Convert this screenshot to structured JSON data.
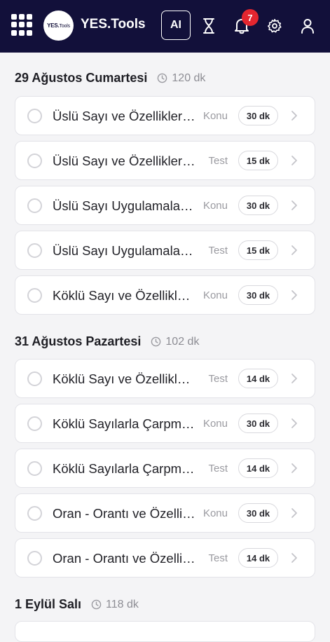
{
  "app": {
    "brand": "YES.Tools",
    "logo_text_bold": "YES.",
    "logo_text_light": "Tools",
    "ai_label": "AI",
    "notification_count": "7"
  },
  "sections": [
    {
      "date": "29 Ağustos Cumartesi",
      "duration": "120 dk",
      "items": [
        {
          "title": "Üslü Sayı ve Özellikleri ...",
          "type": "Konu",
          "duration": "30 dk"
        },
        {
          "title": "Üslü Sayı ve Özellikleri -...",
          "type": "Test",
          "duration": "15 dk"
        },
        {
          "title": "Üslü Sayı Uygulamaları...",
          "type": "Konu",
          "duration": "30 dk"
        },
        {
          "title": "Üslü Sayı Uygulamaları ...",
          "type": "Test",
          "duration": "15 dk"
        },
        {
          "title": "Köklü Sayı ve Özellikler...",
          "type": "Konu",
          "duration": "30 dk"
        }
      ]
    },
    {
      "date": "31 Ağustos Pazartesi",
      "duration": "102 dk",
      "items": [
        {
          "title": "Köklü Sayı ve Özellikleri...",
          "type": "Test",
          "duration": "14 dk"
        },
        {
          "title": "Köklü Sayılarla Çarpma...",
          "type": "Konu",
          "duration": "30 dk"
        },
        {
          "title": "Köklü Sayılarla Çarpma ...",
          "type": "Test",
          "duration": "14 dk"
        },
        {
          "title": "Oran - Orantı ve Özellikl...",
          "type": "Konu",
          "duration": "30 dk"
        },
        {
          "title": "Oran - Orantı ve Özellikl...",
          "type": "Test",
          "duration": "14 dk"
        }
      ]
    },
    {
      "date": "1 Eylül Salı",
      "duration": "118 dk",
      "items": []
    }
  ],
  "colors": {
    "topbar": "#12103a",
    "badge": "#e3262f",
    "background": "#f4f4f6"
  }
}
